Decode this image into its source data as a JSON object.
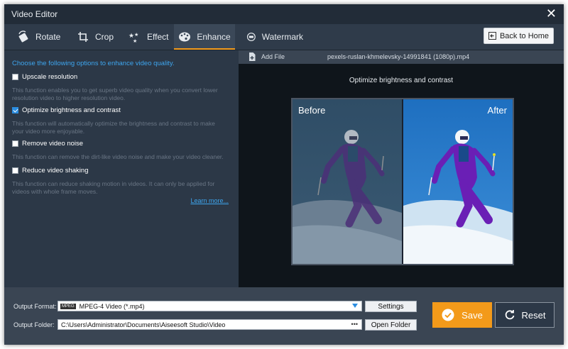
{
  "window": {
    "title": "Video Editor"
  },
  "tabs": [
    {
      "label": "Rotate",
      "icon": "rotate-icon"
    },
    {
      "label": "Crop",
      "icon": "crop-icon"
    },
    {
      "label": "Effect",
      "icon": "effect-stars-icon"
    },
    {
      "label": "Enhance",
      "icon": "palette-icon",
      "active": true
    },
    {
      "label": "Watermark",
      "icon": "watermark-icon"
    }
  ],
  "back_button": {
    "label": "Back to Home"
  },
  "enhance": {
    "intro": "Choose the following options to enhance video quality.",
    "options": [
      {
        "label": "Upscale resolution",
        "checked": false,
        "desc": "This function enables you to get superb video quality when you convert lower resolution video to higher resolution video."
      },
      {
        "label": "Optimize brightness and contrast",
        "checked": true,
        "desc": "This function will automatically optimize the brightness and contrast to make your video more enjoyable."
      },
      {
        "label": "Remove video noise",
        "checked": false,
        "desc": "This function can remove the dirt-like video noise and make your video cleaner."
      },
      {
        "label": "Reduce video shaking",
        "checked": false,
        "desc": "This function can reduce shaking motion in videos. It can only be applied for videos with whole frame moves."
      }
    ],
    "learn_more": "Learn more..."
  },
  "file_bar": {
    "add_label": "Add File",
    "filename": "pexels-ruslan-khmelevsky-14991841 (1080p).mp4"
  },
  "preview": {
    "title": "Optimize brightness and contrast",
    "before": "Before",
    "after": "After"
  },
  "output": {
    "format_label": "Output Format:",
    "format_badge": "MPEG",
    "format_value": "MPEG-4 Video (*.mp4)",
    "settings_label": "Settings",
    "folder_label": "Output Folder:",
    "folder_value": "C:\\Users\\Administrator\\Documents\\Aiseesoft Studio\\Video",
    "browse_label": "•••",
    "open_folder_label": "Open Folder"
  },
  "actions": {
    "save_label": "Save",
    "reset_label": "Reset"
  },
  "colors": {
    "accent": "#f39a1a",
    "link": "#3ea6ef",
    "bg": "#2c3847"
  }
}
